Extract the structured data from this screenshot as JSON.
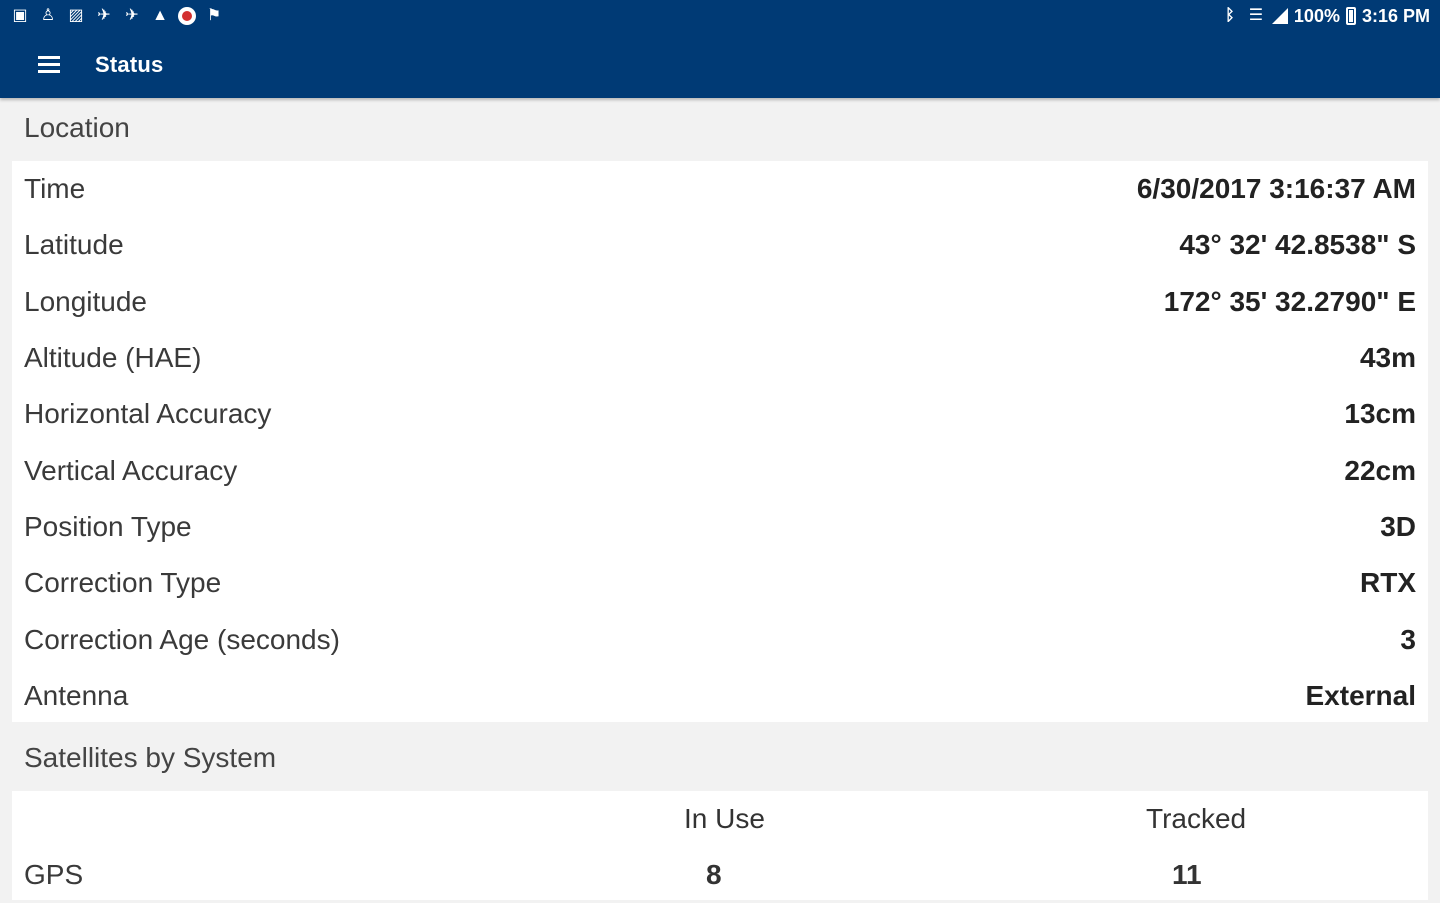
{
  "status_bar": {
    "left_icons": [
      "app-icon",
      "person-icon",
      "image-icon",
      "satellite-icon",
      "satellite-icon",
      "warning-icon",
      "record-icon",
      "flag-icon"
    ],
    "right_icons": [
      "bluetooth-icon",
      "wifi-icon",
      "signal-icon"
    ],
    "battery": "100%",
    "time": "3:16 PM"
  },
  "toolbar": {
    "title": "Status",
    "background": "#003a75"
  },
  "location": {
    "header": "Location",
    "rows": [
      {
        "label": "Time",
        "value": "6/30/2017 3:16:37 AM"
      },
      {
        "label": "Latitude",
        "value": "43° 32' 42.8538\" S"
      },
      {
        "label": "Longitude",
        "value": "172° 35' 32.2790\" E"
      },
      {
        "label": "Altitude (HAE)",
        "value": "43m"
      },
      {
        "label": "Horizontal Accuracy",
        "value": "13cm"
      },
      {
        "label": "Vertical Accuracy",
        "value": "22cm"
      },
      {
        "label": "Position Type",
        "value": "3D"
      },
      {
        "label": "Correction Type",
        "value": "RTX"
      },
      {
        "label": "Correction Age (seconds)",
        "value": "3"
      },
      {
        "label": "Antenna",
        "value": "External"
      }
    ]
  },
  "satellites": {
    "header": "Satellites by System",
    "columns": {
      "in_use": "In Use",
      "tracked": "Tracked"
    },
    "rows": [
      {
        "system": "GPS",
        "in_use": "8",
        "tracked": "11"
      }
    ]
  }
}
